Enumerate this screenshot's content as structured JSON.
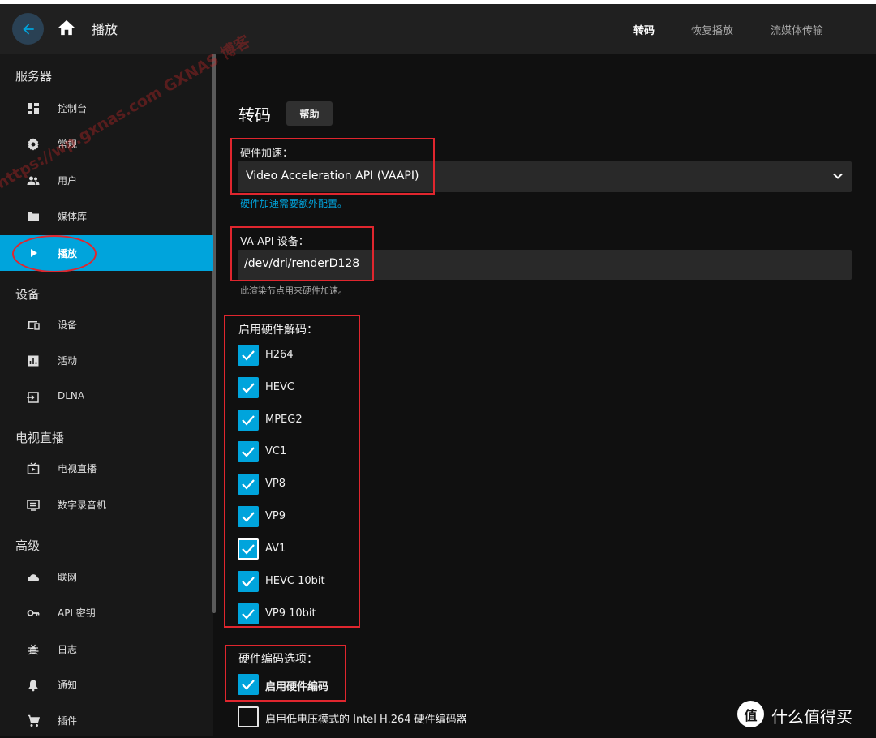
{
  "header": {
    "title": "播放",
    "tabs": [
      {
        "label": "转码",
        "active": true
      },
      {
        "label": "恢复播放",
        "active": false
      },
      {
        "label": "流媒体传输",
        "active": false
      }
    ]
  },
  "sidebar": {
    "sections": [
      {
        "title": "服务器",
        "items": [
          {
            "label": "控制台",
            "icon": "dashboard-icon"
          },
          {
            "label": "常规",
            "icon": "gear-icon"
          },
          {
            "label": "用户",
            "icon": "users-icon"
          },
          {
            "label": "媒体库",
            "icon": "folder-icon"
          },
          {
            "label": "播放",
            "icon": "play-icon",
            "active": true
          }
        ]
      },
      {
        "title": "设备",
        "items": [
          {
            "label": "设备",
            "icon": "devices-icon"
          },
          {
            "label": "活动",
            "icon": "activity-icon"
          },
          {
            "label": "DLNA",
            "icon": "dlna-icon"
          }
        ]
      },
      {
        "title": "电视直播",
        "items": [
          {
            "label": "电视直播",
            "icon": "live-tv-icon"
          },
          {
            "label": "数字录音机",
            "icon": "dvr-icon"
          }
        ]
      },
      {
        "title": "高级",
        "items": [
          {
            "label": "联网",
            "icon": "cloud-icon"
          },
          {
            "label": "API 密钥",
            "icon": "key-icon"
          },
          {
            "label": "日志",
            "icon": "bug-icon"
          },
          {
            "label": "通知",
            "icon": "bell-icon"
          },
          {
            "label": "插件",
            "icon": "cart-icon"
          }
        ]
      }
    ],
    "watermark": "https://wp.gxnas.com GXNAS 博客"
  },
  "main": {
    "title": "转码",
    "help_button": "帮助",
    "hw_accel": {
      "label": "硬件加速：",
      "value": "Video Acceleration API (VAAPI)",
      "help_link": "硬件加速需要额外配置。"
    },
    "vaapi_device": {
      "label": "VA-API 设备：",
      "value": "/dev/dri/renderD128",
      "help": "此渲染节点用来硬件加速。"
    },
    "decoding": {
      "label": "启用硬件解码：",
      "codecs": [
        {
          "label": "H264",
          "checked": true
        },
        {
          "label": "HEVC",
          "checked": true
        },
        {
          "label": "MPEG2",
          "checked": true
        },
        {
          "label": "VC1",
          "checked": true
        },
        {
          "label": "VP8",
          "checked": true
        },
        {
          "label": "VP9",
          "checked": true
        },
        {
          "label": "AV1",
          "checked": true,
          "focused": true
        },
        {
          "label": "HEVC 10bit",
          "checked": true
        },
        {
          "label": "VP9 10bit",
          "checked": true
        }
      ]
    },
    "encoding": {
      "label": "硬件编码选项：",
      "options": [
        {
          "label": "启用硬件编码",
          "checked": true
        },
        {
          "label": "启用低电压模式的 Intel H.264 硬件编码器",
          "checked": false
        }
      ]
    }
  },
  "brand": {
    "text": "什么值得买",
    "logo_char": "值"
  },
  "colors": {
    "accent": "#00a4dc",
    "highlight_red": "#e0262e",
    "background": "#101010",
    "sidebar": "#181818",
    "header": "#202020"
  }
}
